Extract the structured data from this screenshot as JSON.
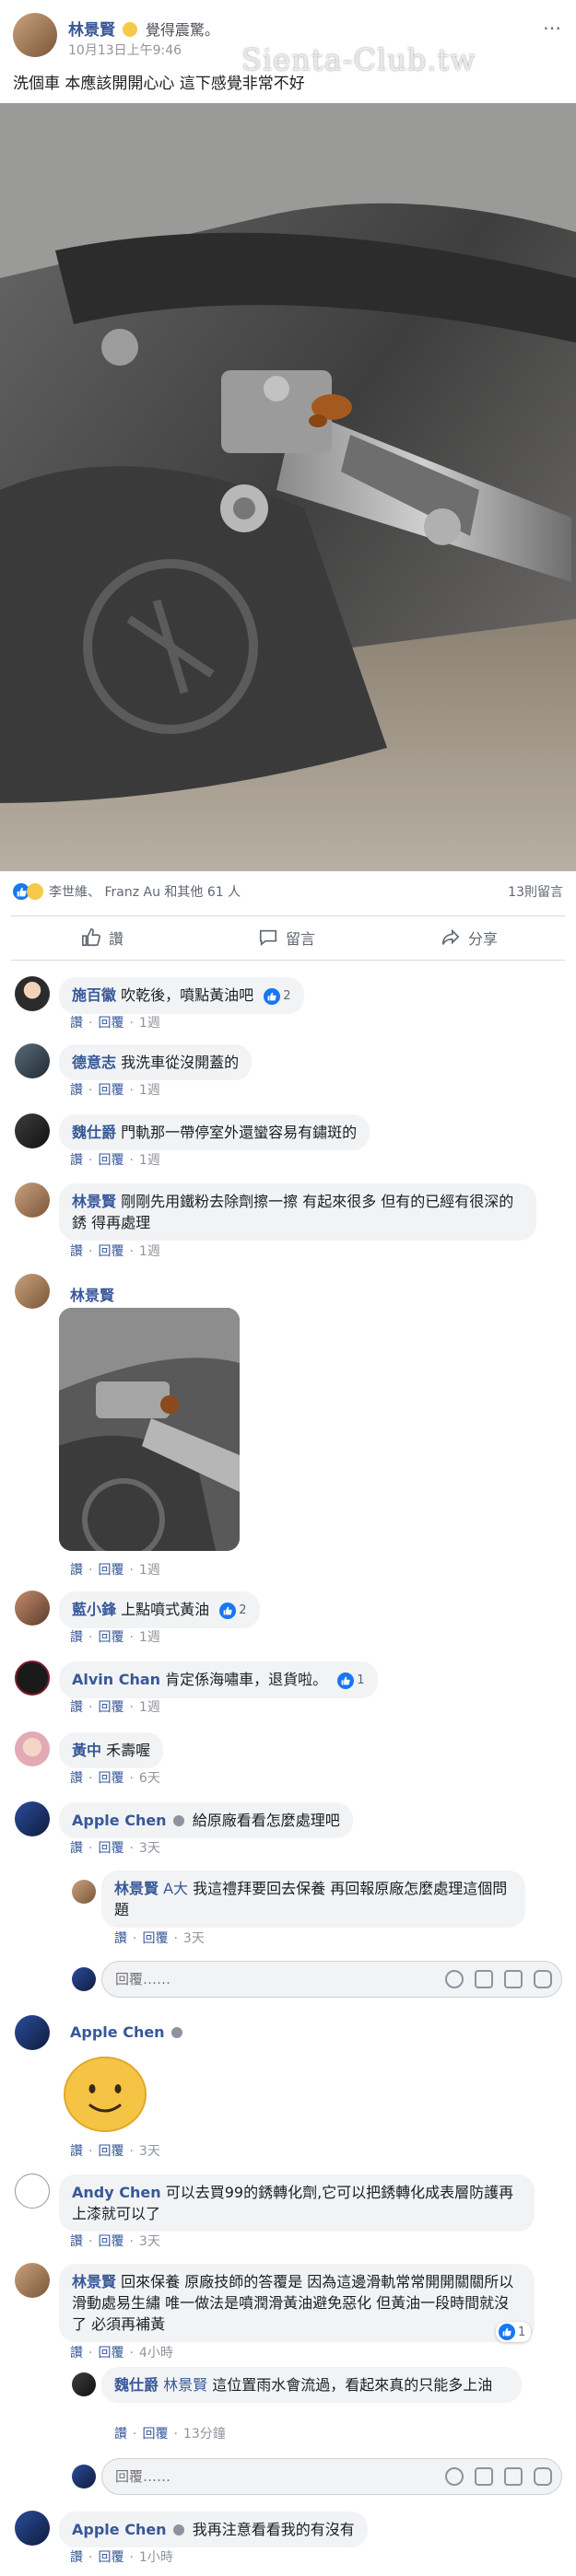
{
  "post": {
    "author": "林景賢",
    "feeling": "覺得震驚。",
    "time": "10月13日上午9:46",
    "text": "洗個車 本應該開開心心 這下感覺非常不好",
    "watermark": "Sienta-Club.tw",
    "reactions_summary": "李世維、 Franz Au 和其他 61 人",
    "comments_count": "13則留言",
    "actions": {
      "like": "讚",
      "comment": "留言",
      "share": "分享"
    }
  },
  "common": {
    "like": "讚",
    "reply": "回覆",
    "input_placeholder": "回覆……"
  },
  "comments": [
    {
      "id": "c1",
      "author": "施百徽",
      "text": "吹乾後，噴點黃油吧",
      "time": "1週",
      "reaction_count": "2"
    },
    {
      "id": "c2",
      "author": "德意志",
      "text": "我洗車從沒開蓋的",
      "time": "1週"
    },
    {
      "id": "c3",
      "author": "魏仕爵",
      "text": "門軌那一帶停室外還蠻容易有鏽斑的",
      "time": "1週"
    },
    {
      "id": "c4",
      "author": "林景賢",
      "text": "剛剛先用鐵粉去除劑擦一擦 有起來很多 但有的已經有很深的銹 得再處理",
      "time": "1週"
    },
    {
      "id": "c5",
      "author": "林景賢",
      "text": "",
      "time": "1週"
    },
    {
      "id": "c6",
      "author": "藍小鋒",
      "text": "上點噴式黃油",
      "time": "1週",
      "reaction_count": "2"
    },
    {
      "id": "c7",
      "author": "Alvin Chan",
      "text": "肯定係海嘯車，退貨啦。",
      "time": "1週",
      "reaction_count": "1"
    },
    {
      "id": "c8",
      "author": "黃中",
      "text": "禾壽喔",
      "time": "6天"
    },
    {
      "id": "c9",
      "author": "Apple Chen",
      "text": "給原廠看看怎麼處理吧",
      "time": "3天"
    },
    {
      "id": "r9",
      "author": "林景賢",
      "mention": "A大",
      "text": " 我這禮拜要回去保養 再回報原廠怎麼處理這個問題",
      "time": "3天"
    },
    {
      "id": "c10",
      "author": "Apple Chen",
      "text": "",
      "time": "3天"
    },
    {
      "id": "c11",
      "author": "Andy Chen",
      "text": "可以去買99的銹轉化劑,它可以把銹轉化成表層防護再上漆就可以了",
      "time": "3天"
    },
    {
      "id": "c12",
      "author": "林景賢",
      "text": "回來保養 原廠技師的答覆是 因為這邊滑軌常常開開關關所以滑動處易生繡 唯一做法是噴潤滑黃油避免惡化 但黃油一段時間就沒了 必須再補黃",
      "time": "4小時",
      "reaction_count": "1"
    },
    {
      "id": "r12",
      "author": "魏仕爵",
      "mention": "林景賢",
      "text": " 這位置雨水會流過，看起來真的只能多上油",
      "time": "13分鐘"
    },
    {
      "id": "c13",
      "author": "Apple Chen",
      "text": "我再注意看看我的有沒有",
      "time": "1小時"
    }
  ],
  "colors": {
    "link": "#385898",
    "like": "#1877f2",
    "bubble": "#f2f3f5"
  }
}
